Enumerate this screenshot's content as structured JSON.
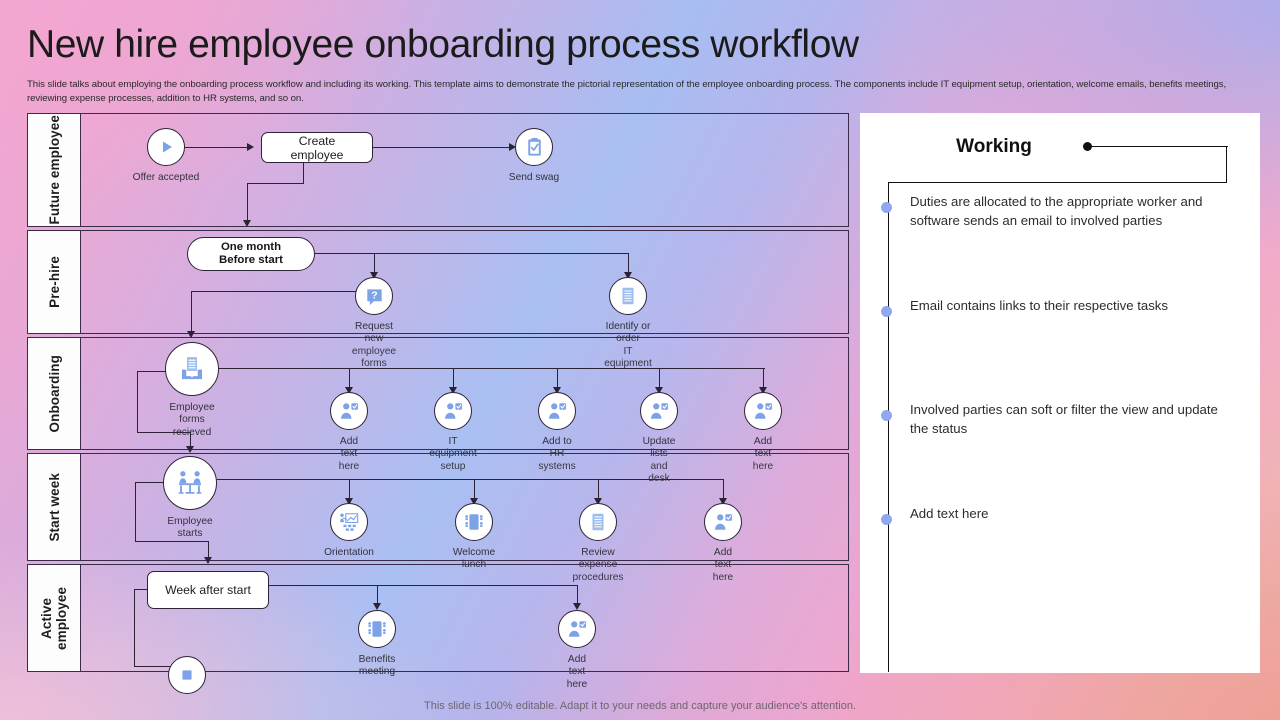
{
  "header": {
    "title": "New hire employee onboarding process workflow",
    "subtitle": "This slide talks about employing the onboarding process workflow and including its working. This template aims to demonstrate the pictorial representation of the employee onboarding process. The components include IT equipment setup, orientation, welcome emails, benefits meetings, reviewing expense processes, addition to HR systems, and so on."
  },
  "footer": {
    "note": "This slide is 100% editable. Adapt it to your needs and capture your audience's attention."
  },
  "diagram": {
    "lanes": [
      {
        "label": "Future employee",
        "nodes": [
          {
            "label": "Offer accepted",
            "icon": "play-icon"
          },
          {
            "label": "Create employee",
            "icon": "process-box"
          },
          {
            "label": "Send swag",
            "icon": "clipboard-check-icon"
          }
        ]
      },
      {
        "label": "Pre-hire",
        "nodes": [
          {
            "label": "One month\nBefore start",
            "icon": "event-pill"
          },
          {
            "label": "Request new\nemployee forms",
            "icon": "question-bubble-icon"
          },
          {
            "label": "Identify or order\nIT equipment",
            "icon": "document-icon"
          }
        ]
      },
      {
        "label": "Onboarding",
        "nodes": [
          {
            "label": "Employee\nforms recieved",
            "icon": "inbox-document-icon"
          },
          {
            "label": "Add\ntext here",
            "icon": "person-check-icon"
          },
          {
            "label": "IT\nequipment setup",
            "icon": "person-check-icon"
          },
          {
            "label": "Add to\nHR systems",
            "icon": "person-check-icon"
          },
          {
            "label": "Update lists\nand desk",
            "icon": "person-check-icon"
          },
          {
            "label": "Add\ntext here",
            "icon": "person-check-icon"
          }
        ]
      },
      {
        "label": "Start week",
        "nodes": [
          {
            "label": "Employee\nstarts",
            "icon": "meeting-table-icon"
          },
          {
            "label": "Orientation",
            "icon": "presentation-icon"
          },
          {
            "label": "Welcome\nlunch",
            "icon": "conference-table-icon"
          },
          {
            "label": "Review\nexpense procedures",
            "icon": "document-icon"
          },
          {
            "label": "Add\ntext here",
            "icon": "person-check-icon"
          }
        ]
      },
      {
        "label": "Active employee",
        "nodes": [
          {
            "label": "Week after start",
            "icon": "event-pill"
          },
          {
            "label": "Benefits\nmeeting",
            "icon": "conference-table-icon"
          },
          {
            "label": "Add\ntext here",
            "icon": "person-check-icon"
          },
          {
            "label": "",
            "icon": "stop-square-icon"
          }
        ]
      }
    ]
  },
  "sidebar": {
    "title": "Working",
    "bullets": [
      "Duties are allocated to the appropriate worker and software sends an email to involved parties",
      "Email contains links to their respective tasks",
      "Involved  parties can soft or filter the view and update the status",
      "Add text here"
    ]
  },
  "colors": {
    "accent_blue": "#8fa8ef",
    "icon_blue": "#7da2e8",
    "line": "#2b2233",
    "lane_label_bg": "#fdfdfd",
    "panel_bg": "#ffffff",
    "text": "#2c2c2c"
  }
}
